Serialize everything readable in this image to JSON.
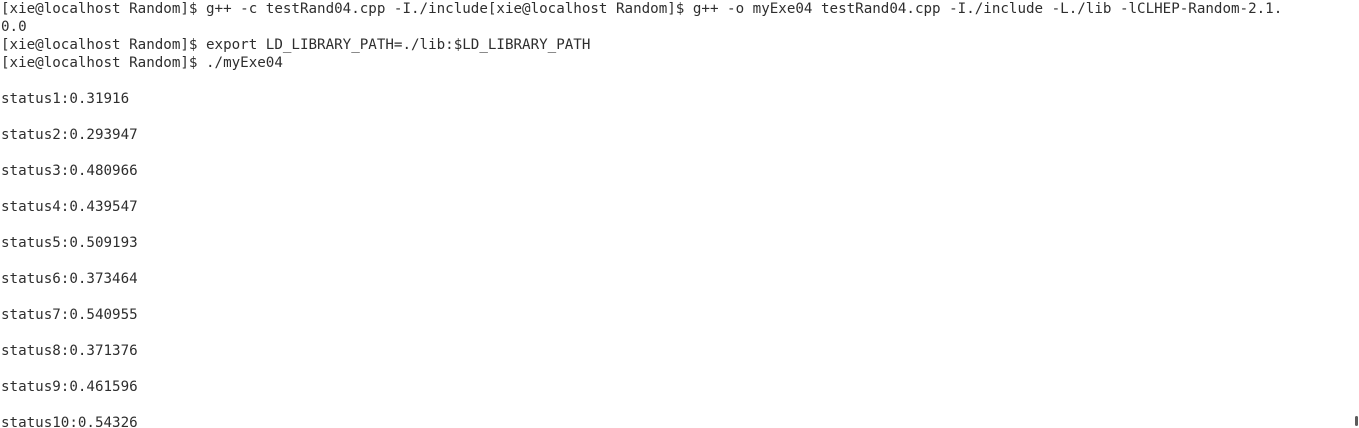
{
  "terminal": {
    "lines": [
      "[xie@localhost Random]$ g++ -c testRand04.cpp -I./include[xie@localhost Random]$ g++ -o myExe04 testRand04.cpp -I./include -L./lib -lCLHEP-Random-2.1.",
      "0.0",
      "[xie@localhost Random]$ export LD_LIBRARY_PATH=./lib:$LD_LIBRARY_PATH",
      "[xie@localhost Random]$ ./myExe04"
    ],
    "outputs": [
      "status1:0.31916",
      "status2:0.293947",
      "status3:0.480966",
      "status4:0.439547",
      "status5:0.509193",
      "status6:0.373464",
      "status7:0.540955",
      "status8:0.371376",
      "status9:0.461596",
      "status10:0.54326"
    ]
  }
}
